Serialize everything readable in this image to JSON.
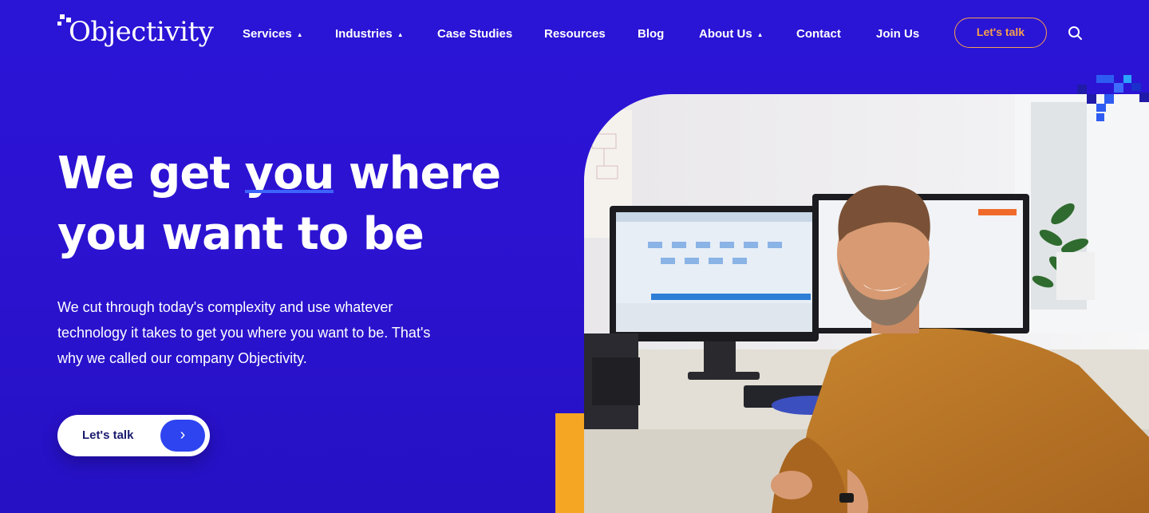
{
  "header": {
    "logo_text": "Objectivity",
    "nav": [
      {
        "label": "Services",
        "dropdown": true
      },
      {
        "label": "Industries",
        "dropdown": true
      },
      {
        "label": "Case Studies",
        "dropdown": false
      },
      {
        "label": "Resources",
        "dropdown": false
      },
      {
        "label": "Blog",
        "dropdown": false
      },
      {
        "label": "About Us",
        "dropdown": true
      },
      {
        "label": "Contact",
        "dropdown": false
      },
      {
        "label": "Join Us",
        "dropdown": false
      }
    ],
    "cta_label": "Let's talk",
    "search_icon": "search-icon"
  },
  "hero": {
    "title_part1": "We get ",
    "title_highlight": "you",
    "title_part2": " where you want to be",
    "description": "We cut through today's complexity and use whatever technology it takes to get you where you want to be. That's why we called our company Objectivity.",
    "cta_label": "Let's talk",
    "cta_icon": "chevron-right-icon"
  },
  "colors": {
    "background": "#2a14d6",
    "accent_orange": "#f5a623",
    "accent_blue": "#2d44f0",
    "highlight_underline": "#3d64ff"
  }
}
